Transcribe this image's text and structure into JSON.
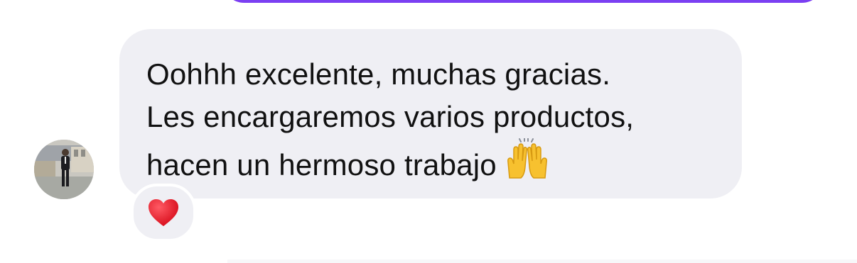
{
  "thread": {
    "previous_message": {
      "sender": "self",
      "accent_color": "#7b3ff2"
    },
    "incoming_message": {
      "lines": [
        "Oohhh excelente, muchas gracias.",
        "Les encargaremos varios productos,",
        "hacen un hermoso trabajo"
      ],
      "trailing_emoji": "raising-hands",
      "bubble_color": "#efeff4",
      "text_color": "#111111"
    },
    "reaction": {
      "emoji": "red-heart",
      "color": "#e8192c"
    },
    "avatar": {
      "icon": "user-photo"
    }
  }
}
